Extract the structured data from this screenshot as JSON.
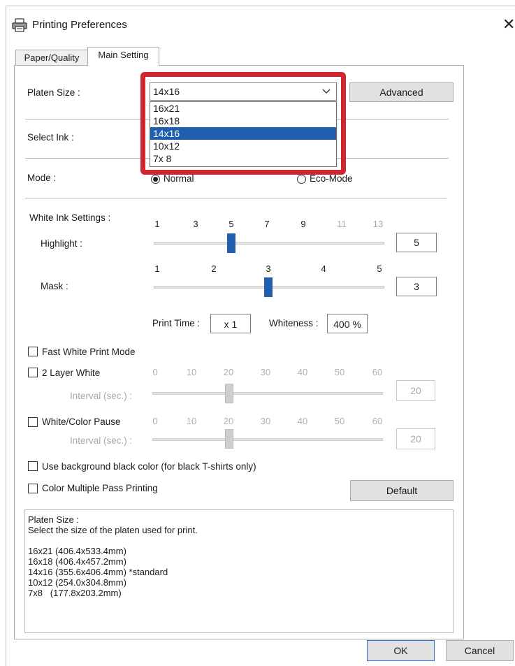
{
  "window": {
    "title": "Printing Preferences",
    "close_glyph": "✕"
  },
  "tabs": [
    {
      "label": "Paper/Quality",
      "active": false
    },
    {
      "label": "Main Setting",
      "active": true
    }
  ],
  "platen": {
    "label": "Platen Size :",
    "selected": "14x16",
    "options": [
      "16x21",
      "16x18",
      "14x16",
      "10x12",
      "7x 8"
    ],
    "advanced_label": "Advanced"
  },
  "select_ink": {
    "label": "Select Ink :"
  },
  "mode": {
    "label": "Mode :",
    "normal_label": "Normal",
    "eco_label": "Eco-Mode",
    "selected": "Normal"
  },
  "white_ink": {
    "label": "White Ink Settings :",
    "highlight": {
      "label": "Highlight :",
      "ticks": [
        "1",
        "3",
        "5",
        "7",
        "9",
        "11",
        "13"
      ],
      "value": "5"
    },
    "mask": {
      "label": "Mask :",
      "ticks": [
        "1",
        "2",
        "3",
        "4",
        "5"
      ],
      "value": "3"
    },
    "print_time_label": "Print Time :",
    "print_time_value": "x 1",
    "whiteness_label": "Whiteness :",
    "whiteness_value": "400 %"
  },
  "options": {
    "fast_white": "Fast White Print Mode",
    "two_layer": "2 Layer White",
    "white_color_pause": "White/Color Pause",
    "interval_label": "Interval (sec.) :",
    "interval_ticks": [
      "0",
      "10",
      "20",
      "30",
      "40",
      "50",
      "60"
    ],
    "interval_value_1": "20",
    "interval_value_2": "20",
    "bg_black": "Use background black color (for black T-shirts only)",
    "color_multi": "Color Multiple Pass Printing",
    "default_label": "Default"
  },
  "description": {
    "lines": [
      "Platen Size :",
      "Select the size of the platen used for print.",
      "",
      "16x21 (406.4x533.4mm)",
      "16x18 (406.4x457.2mm)",
      "14x16 (355.6x406.4mm) *standard",
      "10x12 (254.0x304.8mm)",
      "7x8   (177.8x203.2mm)"
    ]
  },
  "footer": {
    "ok_label": "OK",
    "cancel_label": "Cancel"
  },
  "colors": {
    "accent": "#1f5fae",
    "highlight_box": "#d0262e"
  }
}
